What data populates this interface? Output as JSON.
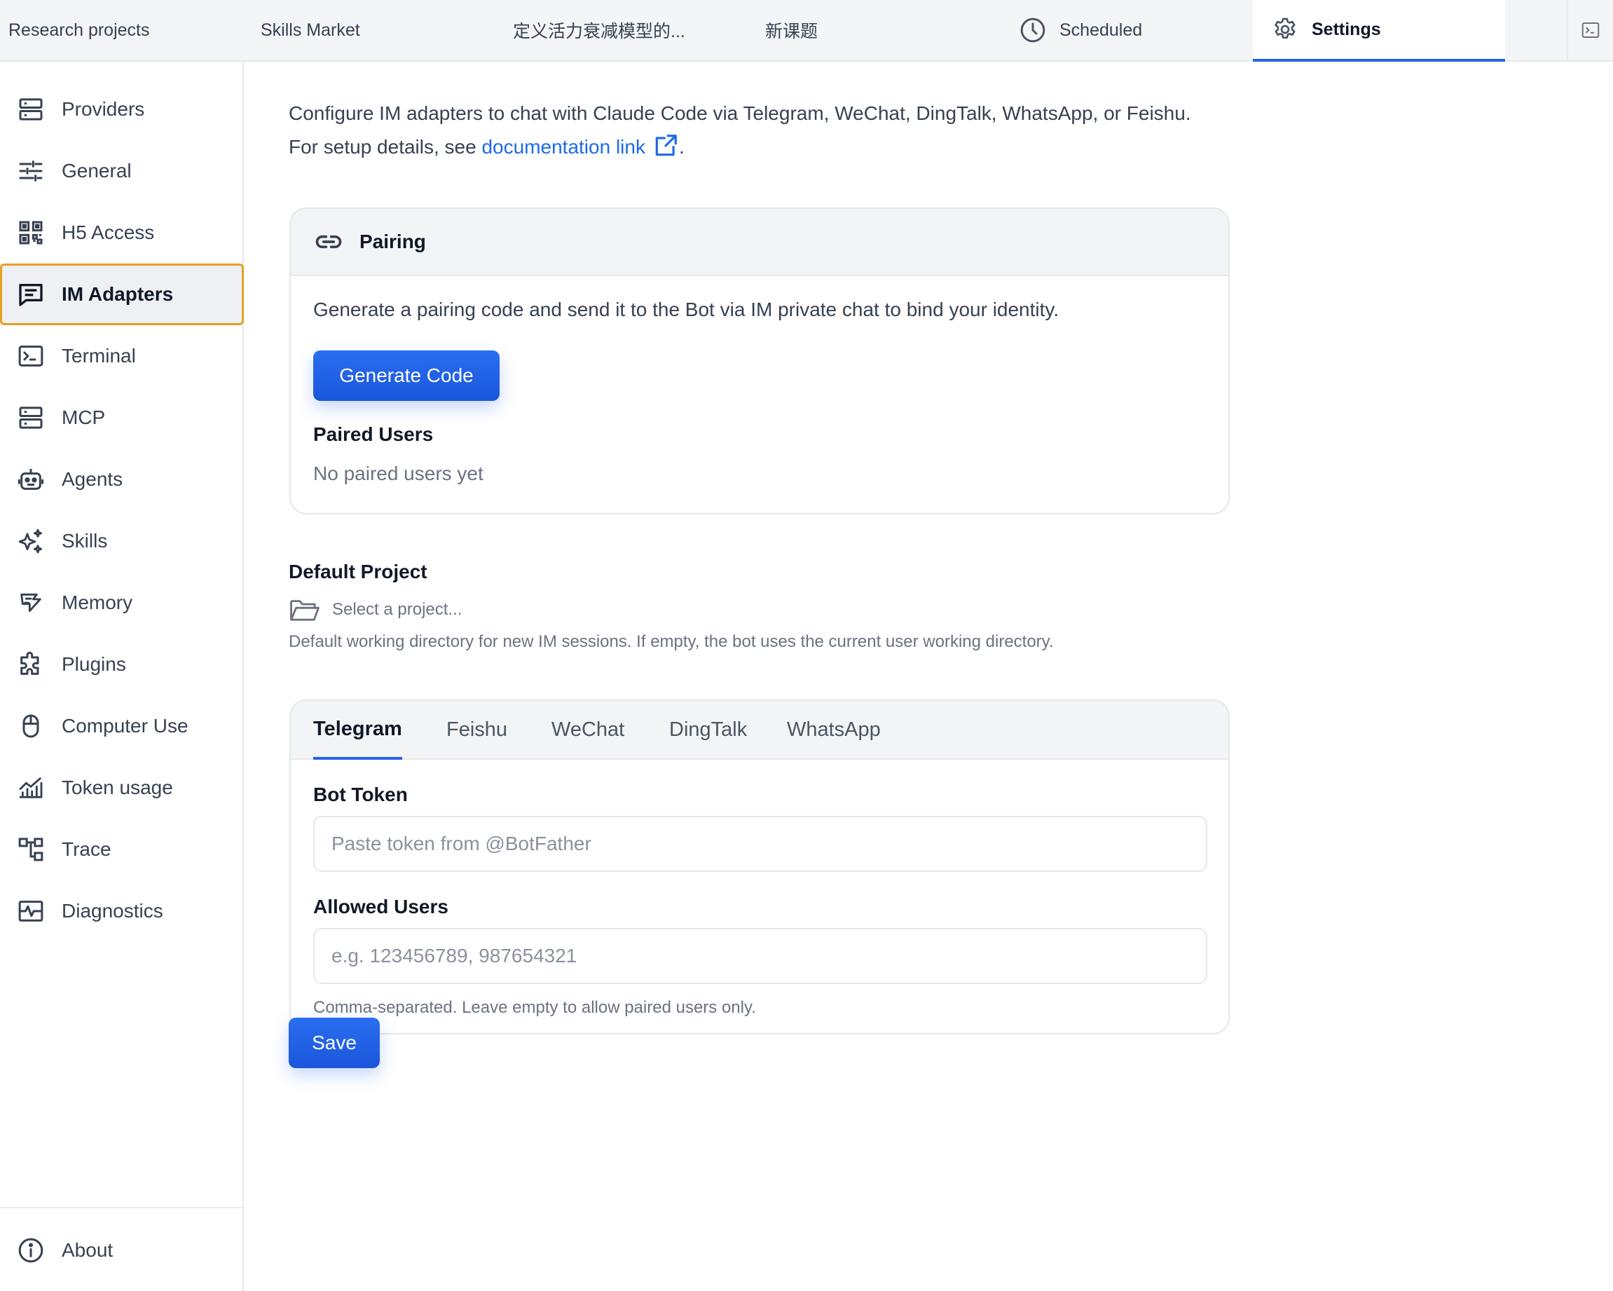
{
  "topbar": {
    "tabs": [
      {
        "label": "Research projects",
        "icon": null
      },
      {
        "label": "Skills Market",
        "icon": null
      },
      {
        "label": "定义活力衰减模型的...",
        "icon": null
      },
      {
        "label": "新课题",
        "icon": null
      },
      {
        "label": "Scheduled",
        "icon": "clock-icon"
      },
      {
        "label": "Settings",
        "icon": "gear-icon",
        "active": true
      }
    ],
    "end_icon": "terminal-panel-icon"
  },
  "sidebar": {
    "items": [
      {
        "label": "Providers",
        "icon": "server-icon"
      },
      {
        "label": "General",
        "icon": "sliders-icon"
      },
      {
        "label": "H5 Access",
        "icon": "qr-code-icon"
      },
      {
        "label": "IM Adapters",
        "icon": "chat-icon",
        "active": true
      },
      {
        "label": "Terminal",
        "icon": "terminal-icon"
      },
      {
        "label": "MCP",
        "icon": "server-icon"
      },
      {
        "label": "Agents",
        "icon": "robot-icon"
      },
      {
        "label": "Skills",
        "icon": "sparkles-icon"
      },
      {
        "label": "Memory",
        "icon": "brain-icon"
      },
      {
        "label": "Plugins",
        "icon": "puzzle-icon"
      },
      {
        "label": "Computer Use",
        "icon": "mouse-icon"
      },
      {
        "label": "Token usage",
        "icon": "chart-icon"
      },
      {
        "label": "Trace",
        "icon": "trace-icon"
      },
      {
        "label": "Diagnostics",
        "icon": "pulse-icon"
      }
    ],
    "about": {
      "label": "About",
      "icon": "info-icon"
    }
  },
  "main": {
    "intro_text": "Configure IM adapters to chat with Claude Code via Telegram, WeChat, DingTalk, WhatsApp, or Feishu. For setup details, see ",
    "doc_link_text": "documentation link",
    "intro_end": ".",
    "pairing": {
      "title": "Pairing",
      "description": "Generate a pairing code and send it to the Bot via IM private chat to bind your identity.",
      "generate_button": "Generate Code",
      "paired_users_title": "Paired Users",
      "paired_users_empty": "No paired users yet"
    },
    "default_project": {
      "title": "Default Project",
      "placeholder": "Select a project...",
      "help": "Default working directory for new IM sessions. If empty, the bot uses the current user working directory."
    },
    "adapters": {
      "tabs": [
        "Telegram",
        "Feishu",
        "WeChat",
        "DingTalk",
        "WhatsApp"
      ],
      "active_tab": "Telegram",
      "bot_token_label": "Bot Token",
      "bot_token_placeholder": "Paste token from @BotFather",
      "bot_token_value": "",
      "allowed_users_label": "Allowed Users",
      "allowed_users_placeholder": "e.g. 123456789, 987654321",
      "allowed_users_value": "",
      "allowed_users_help": "Comma-separated. Leave empty to allow paired users only."
    },
    "save_button": "Save"
  },
  "colors": {
    "accent": "#2563eb",
    "link": "#1d6ae5",
    "active_outline": "#e8a020"
  }
}
